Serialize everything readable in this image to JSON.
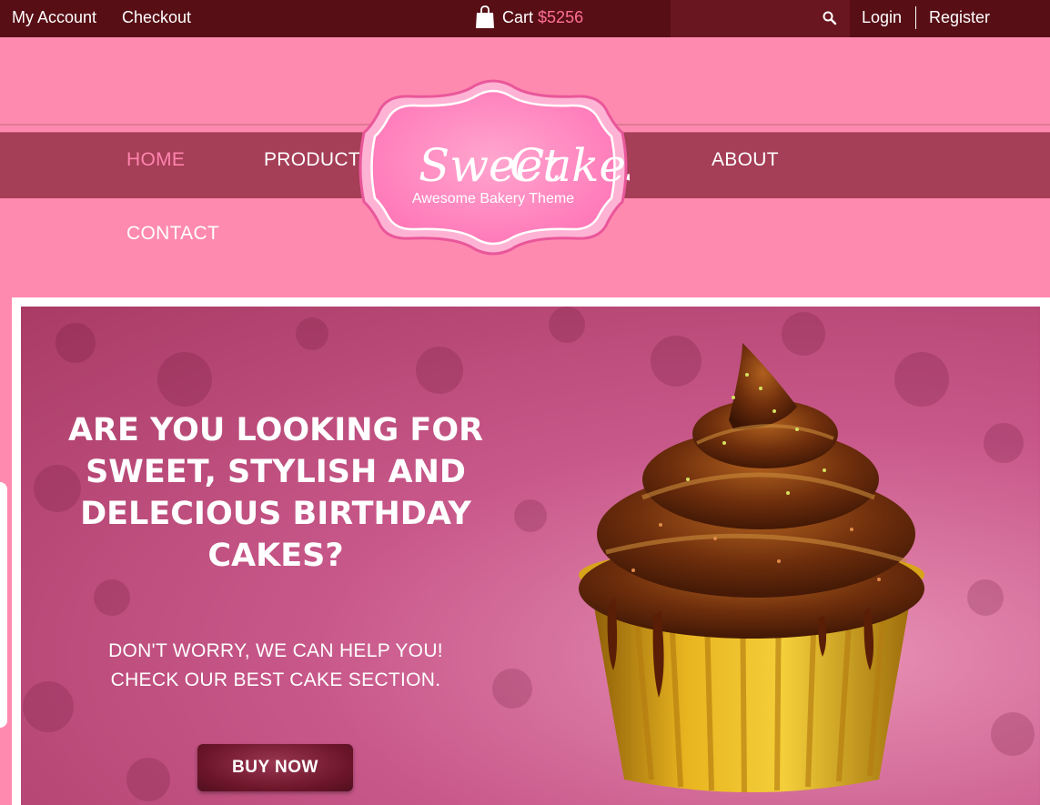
{
  "topbar": {
    "my_account": "My Account",
    "checkout": "Checkout",
    "cart_label": "Cart",
    "cart_amount": "$5256",
    "login": "Login",
    "register": "Register"
  },
  "logo": {
    "title_part1": "Sweet",
    "title_part2": "Cakes",
    "tagline": "Awesome Bakery Theme"
  },
  "nav": {
    "items": [
      {
        "label": "HOME",
        "active": true
      },
      {
        "label": "PRODUCTS"
      },
      {
        "label": "ABOUT"
      },
      {
        "label": "CONTACT"
      }
    ]
  },
  "hero": {
    "headline_lines": [
      "ARE YOU LOOKING FOR",
      "SWEET, STYLISH AND",
      "DELECIOUS BIRTHDAY",
      "CAKES?"
    ],
    "sub_lines": [
      "DON'T WORRY, WE CAN HELP YOU!",
      "CHECK OUR BEST CAKE SECTION."
    ],
    "button_label": "BUY NOW"
  },
  "icons": {
    "cart": "shopping-bag-icon",
    "search": "search-icon"
  },
  "colors": {
    "topbar_bg": "#570e15",
    "page_pink": "#ff8aaf",
    "nav_band": "#a53e57",
    "active_nav": "#ff84ad",
    "cart_amount": "#ff6f96",
    "button": "#6a1428"
  }
}
